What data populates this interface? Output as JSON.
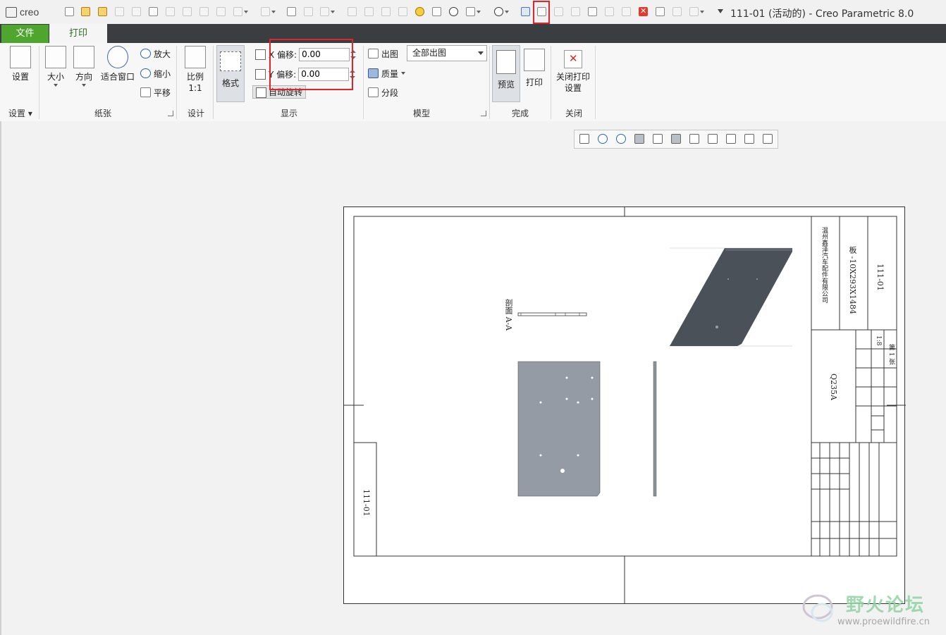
{
  "app": {
    "logo_text": "creo",
    "window_title": "111-01 (活动的) - Creo Parametric 8.0"
  },
  "quick_access": {
    "icons": [
      "new-icon",
      "open-icon",
      "folder-icon",
      "save-icon",
      "save-as-icon",
      "drawing-icon",
      "regenerate-icon",
      "component-icon",
      "insert-icon",
      "assembly-icon",
      "undo-icon",
      "redo-icon",
      "text-icon",
      "sphere-icon",
      "select-box-icon",
      "layer-icon",
      "copy-icon",
      "paste-icon",
      "edit-icon",
      "smile-icon",
      "settings-icon",
      "target-icon",
      "window-icon",
      "counter-icon",
      "print-setup-icon",
      "print-icon",
      "export-icon",
      "import-icon",
      "table-icon",
      "history-icon",
      "close-small-icon",
      "close-red-icon",
      "active-window-icon",
      "switch-window-icon",
      "view-cube-icon"
    ],
    "highlighted": "print-icon"
  },
  "tabs": {
    "file": "文件",
    "print": "打印"
  },
  "ribbon": {
    "settings": {
      "button": "设置",
      "group": "设置"
    },
    "paper": {
      "size": "大小",
      "orientation": "方向",
      "fit_window": "适合窗口",
      "zoom_in": "放大",
      "zoom_out": "缩小",
      "pan": "平移",
      "group": "纸张"
    },
    "design": {
      "scale_line1": "比例",
      "scale_line2": "1:1",
      "group": "设计"
    },
    "display": {
      "format": "格式",
      "x_offset_label": "X 偏移:",
      "x_offset_value": "0.00",
      "y_offset_label": "Y 偏移:",
      "y_offset_value": "0.00",
      "auto_rotate": "自动旋转",
      "group": "显示"
    },
    "model": {
      "drawing": "出图",
      "drawing_select": "全部出图",
      "quality": "质量",
      "segment": "分段",
      "group": "模型"
    },
    "finish": {
      "preview": "预览",
      "print": "打印",
      "group": "完成"
    },
    "close": {
      "close_line1": "关闭打印",
      "close_line2": "设置",
      "group": "关闭"
    }
  },
  "graphics_toolbar": {
    "icons": [
      "refit-icon",
      "zoom-in-icon",
      "zoom-out-icon",
      "repaint-icon",
      "shaded-icon",
      "hidden-line-icon",
      "datum-display-icon",
      "plane-display-icon",
      "axis-display-icon",
      "point-display-icon",
      "csys-display-icon"
    ]
  },
  "drawing": {
    "section_label": "剖面 A-A",
    "title_block": {
      "company": "温州鑫泽汽车配件有限公司",
      "part_name": "板 -10X293X1484",
      "drawing_number": "111-01",
      "material": "Q235A",
      "scale": "1:8",
      "sheet": "第 1 张",
      "rotated_number": "111-01"
    }
  },
  "watermark": {
    "title": "野火论坛",
    "url": "www.proewildfire.cn"
  }
}
